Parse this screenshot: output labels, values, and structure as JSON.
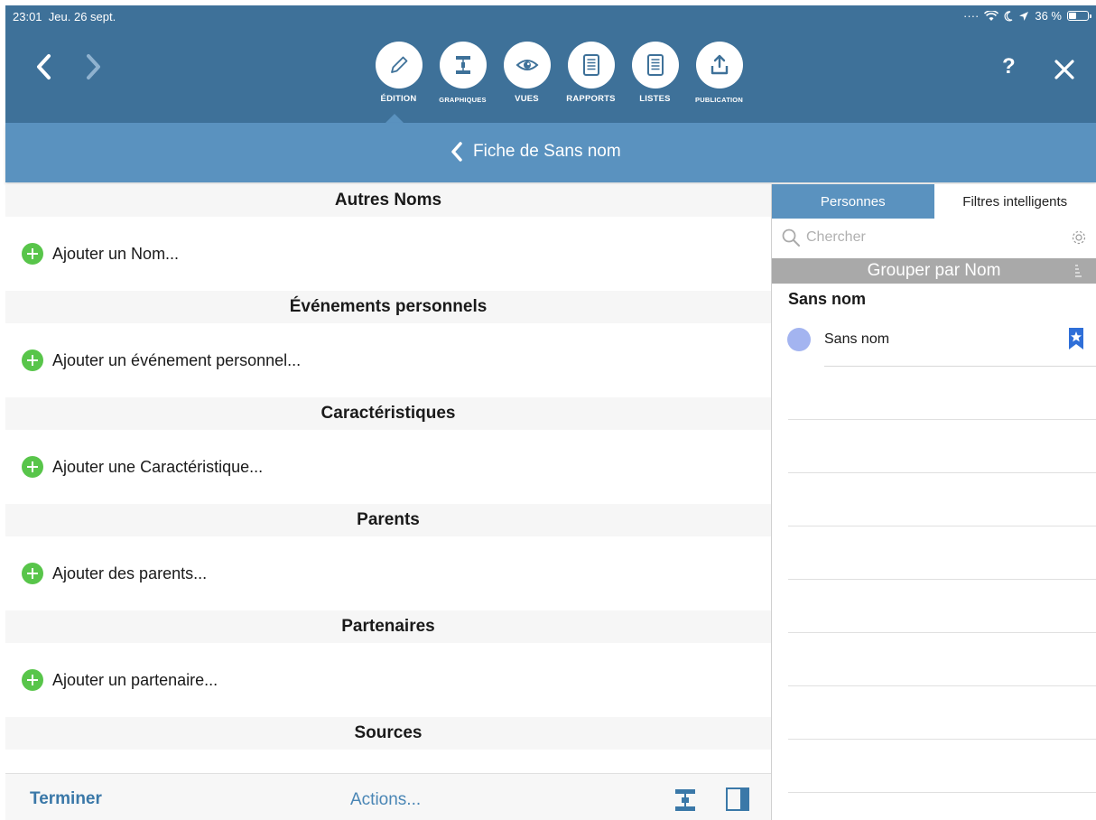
{
  "status": {
    "time": "23:01",
    "date": "Jeu. 26 sept.",
    "battery": "36 %"
  },
  "toolbar": {
    "tools": [
      {
        "label": "ÉDITION",
        "icon": "pencil-icon"
      },
      {
        "label": "GRAPHIQUES",
        "icon": "tree-chart-icon"
      },
      {
        "label": "VUES",
        "icon": "eye-icon"
      },
      {
        "label": "RAPPORTS",
        "icon": "report-icon"
      },
      {
        "label": "LISTES",
        "icon": "list-icon"
      },
      {
        "label": "PUBLICATION",
        "icon": "share-icon"
      }
    ],
    "help_label": "?"
  },
  "subbar": {
    "title": "Fiche de Sans nom"
  },
  "sections": [
    {
      "title": "Autres Noms",
      "add_label": "Ajouter un Nom..."
    },
    {
      "title": "Événements personnels",
      "add_label": "Ajouter un événement personnel..."
    },
    {
      "title": "Caractéristiques",
      "add_label": "Ajouter une Caractéristique..."
    },
    {
      "title": "Parents",
      "add_label": "Ajouter des parents..."
    },
    {
      "title": "Partenaires",
      "add_label": "Ajouter un partenaire..."
    },
    {
      "title": "Sources"
    }
  ],
  "bottombar": {
    "done_label": "Terminer",
    "actions_label": "Actions..."
  },
  "sidebar": {
    "tabs": [
      {
        "label": "Personnes"
      },
      {
        "label": "Filtres intelligents"
      }
    ],
    "search": {
      "placeholder": "Chercher"
    },
    "group_label": "Grouper par Nom",
    "group_name": "Sans nom",
    "persons": [
      {
        "name": "Sans nom"
      }
    ]
  },
  "colors": {
    "topbar": "#3e7199",
    "subbar": "#5a92bf",
    "add_green": "#58c54a",
    "link_blue": "#3a78a8"
  }
}
